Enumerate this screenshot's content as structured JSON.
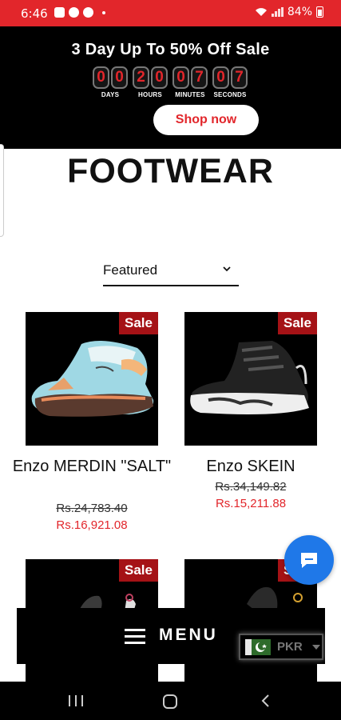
{
  "status_bar": {
    "time": "6:46",
    "battery": "84%",
    "bg_color": "#e2262b"
  },
  "promo": {
    "title": "3 Day Up To 50% Off Sale",
    "countdown": [
      {
        "digits": [
          "0",
          "0"
        ],
        "label": "DAYS"
      },
      {
        "digits": [
          "2",
          "0"
        ],
        "label": "HOURS"
      },
      {
        "digits": [
          "0",
          "7"
        ],
        "label": "MINUTES"
      },
      {
        "digits": [
          "0",
          "7"
        ],
        "label": "SECONDS"
      }
    ],
    "button_label": "Shop now",
    "accent_color": "#e2262b"
  },
  "page": {
    "title": "FOOTWEAR"
  },
  "sort": {
    "selected": "Featured"
  },
  "products": [
    {
      "badge": "Sale",
      "name": "Enzo MERDIN \"SALT\"",
      "price_old": "Rs.24,783.40",
      "price_new": "Rs.16,921.08"
    },
    {
      "badge": "Sale",
      "name": "Enzo SKEIN",
      "price_old": "Rs.34,149.82",
      "price_new": "Rs.15,211.88"
    },
    {
      "badge": "Sale",
      "name": "",
      "price_old": "",
      "price_new": ""
    },
    {
      "badge": "Sale",
      "name": "",
      "price_old": "",
      "price_new": ""
    }
  ],
  "menu_bar": {
    "label": "MENU"
  },
  "currency": {
    "code": "PKR"
  },
  "icons": {
    "chat": "chat-bubble-icon",
    "menu": "hamburger-icon",
    "chevron": "chevron-down-icon",
    "flag": "pakistan-flag-icon"
  }
}
